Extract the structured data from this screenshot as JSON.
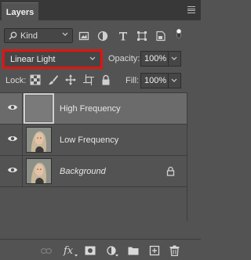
{
  "panel": {
    "tab_label": "Layers"
  },
  "filter": {
    "kind_label": "Kind"
  },
  "blend": {
    "mode": "Linear Light",
    "opacity_label": "Opacity:",
    "opacity_value": "100%"
  },
  "lock": {
    "label": "Lock:",
    "fill_label": "Fill:",
    "fill_value": "100%"
  },
  "layers": [
    {
      "name": "High Frequency",
      "selected": true,
      "visible": true,
      "locked": false,
      "thumbnail": "gray"
    },
    {
      "name": "Low Frequency",
      "selected": false,
      "visible": true,
      "locked": false,
      "thumbnail": "portrait"
    },
    {
      "name": "Background",
      "selected": false,
      "visible": true,
      "locked": true,
      "italic": true,
      "thumbnail": "portrait"
    }
  ],
  "colors": {
    "highlight": "#e3140f",
    "panel": "#535353",
    "selected_row": "#6b6b6b"
  },
  "bottom_icons": [
    "link-layers-icon",
    "fx-icon",
    "add-mask-icon",
    "adjustment-layer-icon",
    "group-folder-icon",
    "new-layer-icon",
    "trash-icon"
  ]
}
